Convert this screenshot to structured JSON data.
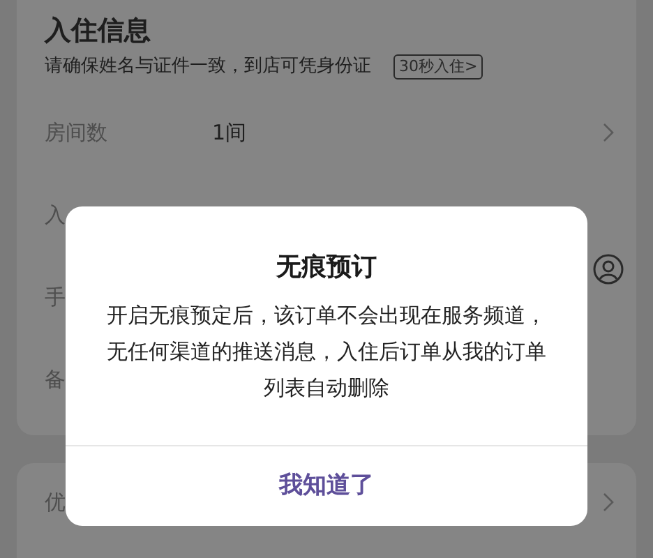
{
  "checkin_card": {
    "title": "入住信息",
    "subtitle": "请确保姓名与证件一致，到店可凭身份证",
    "badge": "30秒入住>",
    "rows": [
      {
        "kind": "value",
        "label": "房间数",
        "value": "1间"
      },
      {
        "kind": "plain",
        "label": "入"
      },
      {
        "kind": "contact",
        "label": "手"
      },
      {
        "kind": "plain",
        "label": "备"
      }
    ]
  },
  "offer_card": {
    "rows": [
      {
        "kind": "arrow",
        "label": "优"
      }
    ]
  },
  "dialog": {
    "title": "无痕预订",
    "message": "开启无痕预定后，该订单不会出现在服务频道，无任何渠道的推送消息，入住后订单从我的订单列表自动删除",
    "button": "我知道了"
  }
}
